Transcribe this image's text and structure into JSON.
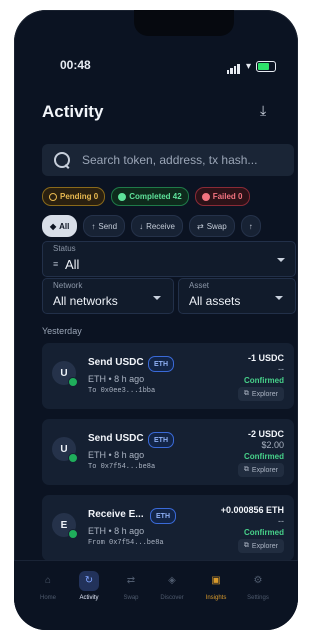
{
  "status_bar": {
    "time": "00:48"
  },
  "header": {
    "title": "Activity"
  },
  "search": {
    "placeholder": "Search token, address, tx hash..."
  },
  "summary_pills": [
    {
      "label": "Pending 0"
    },
    {
      "label": "Completed 42"
    },
    {
      "label": "Failed 0"
    }
  ],
  "type_filters": [
    "All",
    "Send",
    "Receive",
    "Swap"
  ],
  "filters": {
    "status_label": "Status",
    "status_value": "All",
    "network_label": "Network",
    "network_value": "All networks",
    "asset_label": "Asset",
    "asset_value": "All assets"
  },
  "section_label": "Yesterday",
  "transactions": [
    {
      "avatar": "U",
      "title": "Send USDC",
      "network_tag": "ETH",
      "meta": "ETH • 8 h ago",
      "address": "To 0x0ee3...1bba",
      "amount": "-1 USDC",
      "fiat": "--",
      "status": "Confirmed",
      "explorer": "Explorer"
    },
    {
      "avatar": "U",
      "title": "Send USDC",
      "network_tag": "ETH",
      "meta": "ETH • 8 h ago",
      "address": "To 0x7f54...be8a",
      "amount": "-2 USDC",
      "fiat": "$2.00",
      "status": "Confirmed",
      "explorer": "Explorer"
    },
    {
      "avatar": "E",
      "title": "Receive E...",
      "network_tag": "ETH",
      "meta": "ETH • 8 h ago",
      "address": "From 0x7f54...be8a",
      "amount": "+0.000856 ETH",
      "fiat": "--",
      "status": "Confirmed",
      "explorer": "Explorer"
    }
  ],
  "tabs": [
    {
      "label": "Home"
    },
    {
      "label": "Activity"
    },
    {
      "label": "Swap"
    },
    {
      "label": "Discover"
    },
    {
      "label": "Insights"
    },
    {
      "label": "Settings"
    }
  ],
  "colors": {
    "accent": "#7fa4ff",
    "confirmed": "#47d18a",
    "insights": "#d99a2c"
  }
}
